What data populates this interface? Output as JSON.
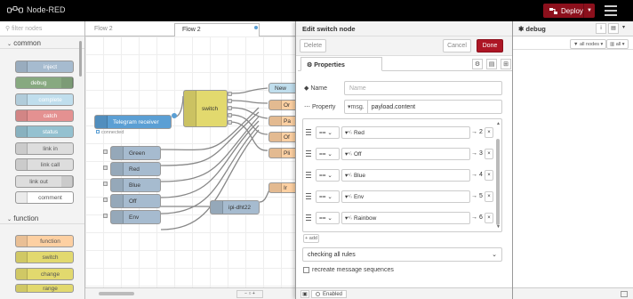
{
  "header": {
    "app_title": "Node-RED",
    "deploy_label": "Deploy"
  },
  "palette": {
    "search_placeholder": "filter nodes",
    "categories": [
      "common",
      "function"
    ],
    "common_nodes": [
      "inject",
      "debug",
      "complete",
      "catch",
      "status",
      "link in",
      "link call",
      "link out",
      "comment"
    ],
    "function_nodes": [
      "function",
      "switch",
      "change",
      "range"
    ]
  },
  "workspace": {
    "tabs": [
      "Flow 2",
      "Flow 2"
    ],
    "nodes": {
      "switch": "switch",
      "telegram": "Telegram receiver",
      "telegram_status": "connected",
      "green": "Green",
      "red": "Red",
      "blue": "Blue",
      "off": "Off",
      "env": "Env",
      "ipi": "ipi-dht22",
      "new": "New",
      "right_labels": [
        "Or",
        "Pa",
        "Of",
        "Pli",
        "Ir"
      ]
    }
  },
  "tray": {
    "title": "Edit switch node",
    "delete_label": "Delete",
    "cancel_label": "Cancel",
    "done_label": "Done",
    "properties_tab": "Properties",
    "name_label": "Name",
    "name_placeholder": "Name",
    "property_label": "Property",
    "property_type": "msg.",
    "property_value": "payload.content",
    "rules": [
      {
        "op": "==",
        "value": "Red",
        "port": "→ 2"
      },
      {
        "op": "==",
        "value": "Off",
        "port": "→ 3"
      },
      {
        "op": "==",
        "value": "Blue",
        "port": "→ 4"
      },
      {
        "op": "==",
        "value": "Env",
        "port": "→ 5"
      },
      {
        "op": "==",
        "value": "Rainbow",
        "port": "→ 6"
      }
    ],
    "add_label": "+ add",
    "check_mode": "checking all rules",
    "recreate_label": "recreate message sequences",
    "enabled_label": "Enabled"
  },
  "sidebar": {
    "title": "debug",
    "filter_label": "all nodes",
    "clear_label": "all"
  },
  "colors": {
    "header_bg": "#000000",
    "deploy_red": "#8c101c",
    "done_red": "#ad1625",
    "inject_blue": "#a6bbcf",
    "debug_green": "#87a980",
    "function_orange": "#fdd0a2",
    "switch_yellow": "#e2d96e",
    "catch_red": "#e49191",
    "telegram_blue": "#5b9fd4",
    "gray_node": "#a6bbcf"
  }
}
